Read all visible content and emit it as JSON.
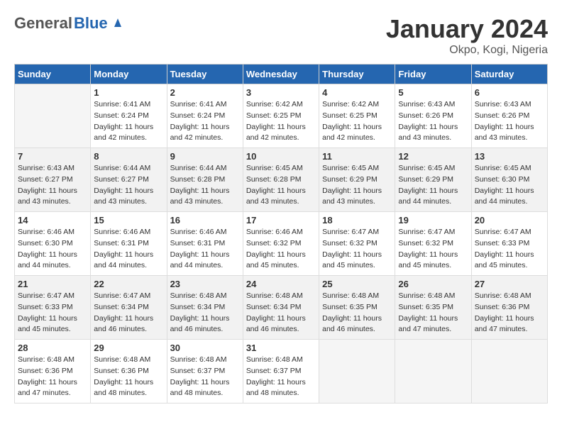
{
  "header": {
    "logo_general": "General",
    "logo_blue": "Blue",
    "month_title": "January 2024",
    "location": "Okpo, Kogi, Nigeria"
  },
  "weekdays": [
    "Sunday",
    "Monday",
    "Tuesday",
    "Wednesday",
    "Thursday",
    "Friday",
    "Saturday"
  ],
  "weeks": [
    [
      {
        "day": "",
        "sunrise": "",
        "sunset": "",
        "daylight": ""
      },
      {
        "day": "1",
        "sunrise": "Sunrise: 6:41 AM",
        "sunset": "Sunset: 6:24 PM",
        "daylight": "Daylight: 11 hours and 42 minutes."
      },
      {
        "day": "2",
        "sunrise": "Sunrise: 6:41 AM",
        "sunset": "Sunset: 6:24 PM",
        "daylight": "Daylight: 11 hours and 42 minutes."
      },
      {
        "day": "3",
        "sunrise": "Sunrise: 6:42 AM",
        "sunset": "Sunset: 6:25 PM",
        "daylight": "Daylight: 11 hours and 42 minutes."
      },
      {
        "day": "4",
        "sunrise": "Sunrise: 6:42 AM",
        "sunset": "Sunset: 6:25 PM",
        "daylight": "Daylight: 11 hours and 42 minutes."
      },
      {
        "day": "5",
        "sunrise": "Sunrise: 6:43 AM",
        "sunset": "Sunset: 6:26 PM",
        "daylight": "Daylight: 11 hours and 43 minutes."
      },
      {
        "day": "6",
        "sunrise": "Sunrise: 6:43 AM",
        "sunset": "Sunset: 6:26 PM",
        "daylight": "Daylight: 11 hours and 43 minutes."
      }
    ],
    [
      {
        "day": "7",
        "sunrise": "Sunrise: 6:43 AM",
        "sunset": "Sunset: 6:27 PM",
        "daylight": "Daylight: 11 hours and 43 minutes."
      },
      {
        "day": "8",
        "sunrise": "Sunrise: 6:44 AM",
        "sunset": "Sunset: 6:27 PM",
        "daylight": "Daylight: 11 hours and 43 minutes."
      },
      {
        "day": "9",
        "sunrise": "Sunrise: 6:44 AM",
        "sunset": "Sunset: 6:28 PM",
        "daylight": "Daylight: 11 hours and 43 minutes."
      },
      {
        "day": "10",
        "sunrise": "Sunrise: 6:45 AM",
        "sunset": "Sunset: 6:28 PM",
        "daylight": "Daylight: 11 hours and 43 minutes."
      },
      {
        "day": "11",
        "sunrise": "Sunrise: 6:45 AM",
        "sunset": "Sunset: 6:29 PM",
        "daylight": "Daylight: 11 hours and 43 minutes."
      },
      {
        "day": "12",
        "sunrise": "Sunrise: 6:45 AM",
        "sunset": "Sunset: 6:29 PM",
        "daylight": "Daylight: 11 hours and 44 minutes."
      },
      {
        "day": "13",
        "sunrise": "Sunrise: 6:45 AM",
        "sunset": "Sunset: 6:30 PM",
        "daylight": "Daylight: 11 hours and 44 minutes."
      }
    ],
    [
      {
        "day": "14",
        "sunrise": "Sunrise: 6:46 AM",
        "sunset": "Sunset: 6:30 PM",
        "daylight": "Daylight: 11 hours and 44 minutes."
      },
      {
        "day": "15",
        "sunrise": "Sunrise: 6:46 AM",
        "sunset": "Sunset: 6:31 PM",
        "daylight": "Daylight: 11 hours and 44 minutes."
      },
      {
        "day": "16",
        "sunrise": "Sunrise: 6:46 AM",
        "sunset": "Sunset: 6:31 PM",
        "daylight": "Daylight: 11 hours and 44 minutes."
      },
      {
        "day": "17",
        "sunrise": "Sunrise: 6:46 AM",
        "sunset": "Sunset: 6:32 PM",
        "daylight": "Daylight: 11 hours and 45 minutes."
      },
      {
        "day": "18",
        "sunrise": "Sunrise: 6:47 AM",
        "sunset": "Sunset: 6:32 PM",
        "daylight": "Daylight: 11 hours and 45 minutes."
      },
      {
        "day": "19",
        "sunrise": "Sunrise: 6:47 AM",
        "sunset": "Sunset: 6:32 PM",
        "daylight": "Daylight: 11 hours and 45 minutes."
      },
      {
        "day": "20",
        "sunrise": "Sunrise: 6:47 AM",
        "sunset": "Sunset: 6:33 PM",
        "daylight": "Daylight: 11 hours and 45 minutes."
      }
    ],
    [
      {
        "day": "21",
        "sunrise": "Sunrise: 6:47 AM",
        "sunset": "Sunset: 6:33 PM",
        "daylight": "Daylight: 11 hours and 45 minutes."
      },
      {
        "day": "22",
        "sunrise": "Sunrise: 6:47 AM",
        "sunset": "Sunset: 6:34 PM",
        "daylight": "Daylight: 11 hours and 46 minutes."
      },
      {
        "day": "23",
        "sunrise": "Sunrise: 6:48 AM",
        "sunset": "Sunset: 6:34 PM",
        "daylight": "Daylight: 11 hours and 46 minutes."
      },
      {
        "day": "24",
        "sunrise": "Sunrise: 6:48 AM",
        "sunset": "Sunset: 6:34 PM",
        "daylight": "Daylight: 11 hours and 46 minutes."
      },
      {
        "day": "25",
        "sunrise": "Sunrise: 6:48 AM",
        "sunset": "Sunset: 6:35 PM",
        "daylight": "Daylight: 11 hours and 46 minutes."
      },
      {
        "day": "26",
        "sunrise": "Sunrise: 6:48 AM",
        "sunset": "Sunset: 6:35 PM",
        "daylight": "Daylight: 11 hours and 47 minutes."
      },
      {
        "day": "27",
        "sunrise": "Sunrise: 6:48 AM",
        "sunset": "Sunset: 6:36 PM",
        "daylight": "Daylight: 11 hours and 47 minutes."
      }
    ],
    [
      {
        "day": "28",
        "sunrise": "Sunrise: 6:48 AM",
        "sunset": "Sunset: 6:36 PM",
        "daylight": "Daylight: 11 hours and 47 minutes."
      },
      {
        "day": "29",
        "sunrise": "Sunrise: 6:48 AM",
        "sunset": "Sunset: 6:36 PM",
        "daylight": "Daylight: 11 hours and 48 minutes."
      },
      {
        "day": "30",
        "sunrise": "Sunrise: 6:48 AM",
        "sunset": "Sunset: 6:37 PM",
        "daylight": "Daylight: 11 hours and 48 minutes."
      },
      {
        "day": "31",
        "sunrise": "Sunrise: 6:48 AM",
        "sunset": "Sunset: 6:37 PM",
        "daylight": "Daylight: 11 hours and 48 minutes."
      },
      {
        "day": "",
        "sunrise": "",
        "sunset": "",
        "daylight": ""
      },
      {
        "day": "",
        "sunrise": "",
        "sunset": "",
        "daylight": ""
      },
      {
        "day": "",
        "sunrise": "",
        "sunset": "",
        "daylight": ""
      }
    ]
  ]
}
